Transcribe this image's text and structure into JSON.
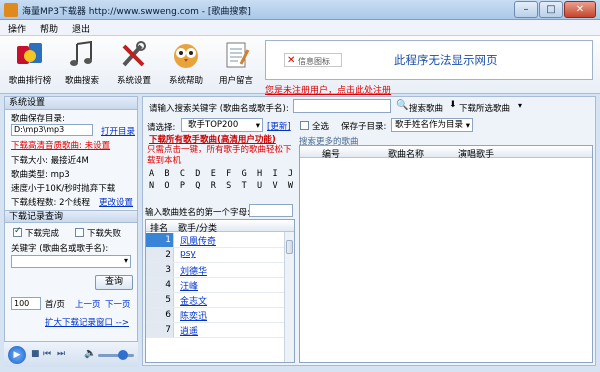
{
  "window": {
    "title": "海量MP3下载器  http://www.swweng.com - [歌曲搜索]",
    "minimize": "–",
    "maximize": "□",
    "close": "✕"
  },
  "menu": [
    "操作",
    "帮助",
    "退出"
  ],
  "toolbar": [
    {
      "label": "歌曲排行榜",
      "icon": "ranking-icon"
    },
    {
      "label": "歌曲搜索",
      "icon": "music-notes-icon"
    },
    {
      "label": "系统设置",
      "icon": "tools-icon"
    },
    {
      "label": "系统帮助",
      "icon": "owl-help-icon"
    },
    {
      "label": "用户留言",
      "icon": "notepad-icon"
    }
  ],
  "ad": {
    "error_label": "信息图标",
    "message": "此程序无法显示网页"
  },
  "register_notice": "您是未注册用户，点击此处注册",
  "system_settings": {
    "header": "系统设置",
    "save_dir_label": "歌曲保存目录:",
    "save_dir_value": "D:\\mp3\\mp3",
    "open_dir": "打开目录",
    "warning": "下载高清音质歌曲: 未设置",
    "size_label": "下载大小: 最接近4M",
    "type_label": "歌曲类型: mp3",
    "speed_label": "速度小于10K/秒时抛弃下载",
    "threads_label": "下载线程数: 2个线程",
    "change_settings": "更改设置"
  },
  "download_query": {
    "header": "下载记录查询",
    "completed": "下载完成",
    "failed": "下载失败",
    "keyword_label": "关键字 (歌曲名或歌手名):",
    "query_button": "查询",
    "page_size": "100",
    "per_page": "首/页",
    "prev_page": "上一页",
    "next_page": "下一页",
    "expand": "扩大下载记录窗口 -->"
  },
  "search": {
    "prompt": "请输入搜索关键字 (歌曲名或歌手名):",
    "search_button": "搜索歌曲",
    "download_selected": "下载所选歌曲",
    "select_label": "请选择:",
    "select_value": "歌手TOP200",
    "update": "[更新]",
    "select_all": "全选",
    "save_to_label": "保存子目录:",
    "save_to_value": "歌手姓名作为目录"
  },
  "hq_link": "下载所有歌手歌曲(高清用户功能)",
  "hq_note": "只需点击一键，所有歌手的歌曲轻松下载到本机",
  "results_label": "搜索更多的歌曲",
  "alphabet": [
    "A B C D E F G H I J K L M",
    "N O P Q R S T U V W X Y Z"
  ],
  "first_letter_label": "输入歌曲姓名的第一个字母:",
  "singer_table": {
    "headers": [
      "排名",
      "歌手/分类"
    ],
    "rows": [
      {
        "rank": "1",
        "name": "凤凰传奇"
      },
      {
        "rank": "2",
        "name": "psy"
      },
      {
        "rank": "3",
        "name": "刘德华"
      },
      {
        "rank": "4",
        "name": "汪峰"
      },
      {
        "rank": "5",
        "name": "金志文"
      },
      {
        "rank": "6",
        "name": "陈奕迅"
      },
      {
        "rank": "7",
        "name": "逍遥"
      }
    ]
  },
  "result_table": {
    "headers": [
      "编号",
      "歌曲名称",
      "演唱歌手"
    ]
  }
}
